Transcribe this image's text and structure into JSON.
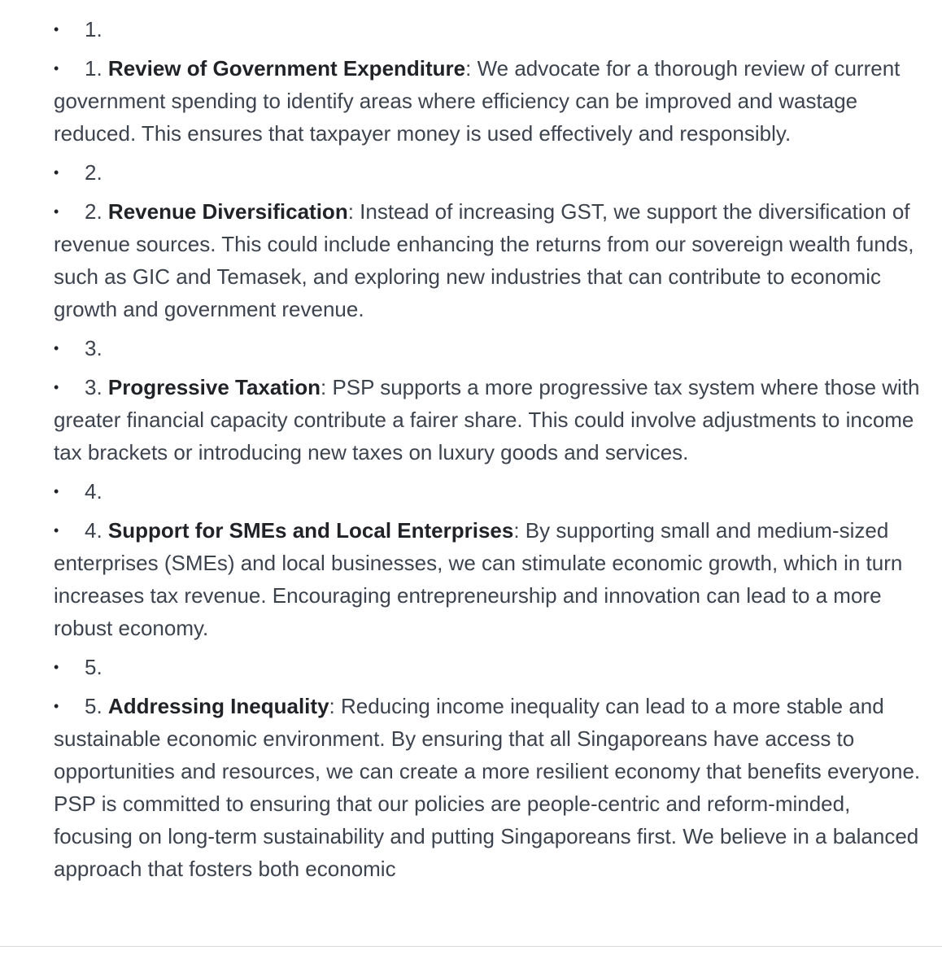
{
  "items": [
    {
      "type": "number-only",
      "number": "1."
    },
    {
      "type": "point",
      "number": "1.",
      "title": "Review of Government Expenditure",
      "text": ": We advocate for a thorough review of current government spending to identify areas where efficiency can be improved and wastage reduced. This ensures that taxpayer money is used effectively and responsibly."
    },
    {
      "type": "number-only",
      "number": "2."
    },
    {
      "type": "point",
      "number": "2.",
      "title": "Revenue Diversification",
      "text": ": Instead of increasing GST, we support the diversification of revenue sources. This could include enhancing the returns from our sovereign wealth funds, such as GIC and Temasek, and exploring new industries that can contribute to economic growth and government revenue."
    },
    {
      "type": "number-only",
      "number": "3."
    },
    {
      "type": "point",
      "number": "3.",
      "title": "Progressive Taxation",
      "text": ": PSP supports a more progressive tax system where those with greater financial capacity contribute a fairer share. This could involve adjustments to income tax brackets or introducing new taxes on luxury goods and services."
    },
    {
      "type": "number-only",
      "number": "4."
    },
    {
      "type": "point",
      "number": "4.",
      "title": "Support for SMEs and Local Enterprises",
      "text": ": By supporting small and medium-sized enterprises (SMEs) and local businesses, we can stimulate economic growth, which in turn increases tax revenue. Encouraging entrepreneurship and innovation can lead to a more robust economy."
    },
    {
      "type": "number-only",
      "number": "5."
    },
    {
      "type": "point",
      "number": "5.",
      "title": "Addressing Inequality",
      "text": ": Reducing income inequality can lead to a more stable and sustainable economic environment. By ensuring that all Singaporeans have access to opportunities and resources, we can create a more resilient economy that benefits everyone. PSP is committed to ensuring that our policies are people-centric and reform-minded, focusing on long-term sustainability and putting Singaporeans first. We believe in a balanced approach that fosters both economic"
    }
  ]
}
